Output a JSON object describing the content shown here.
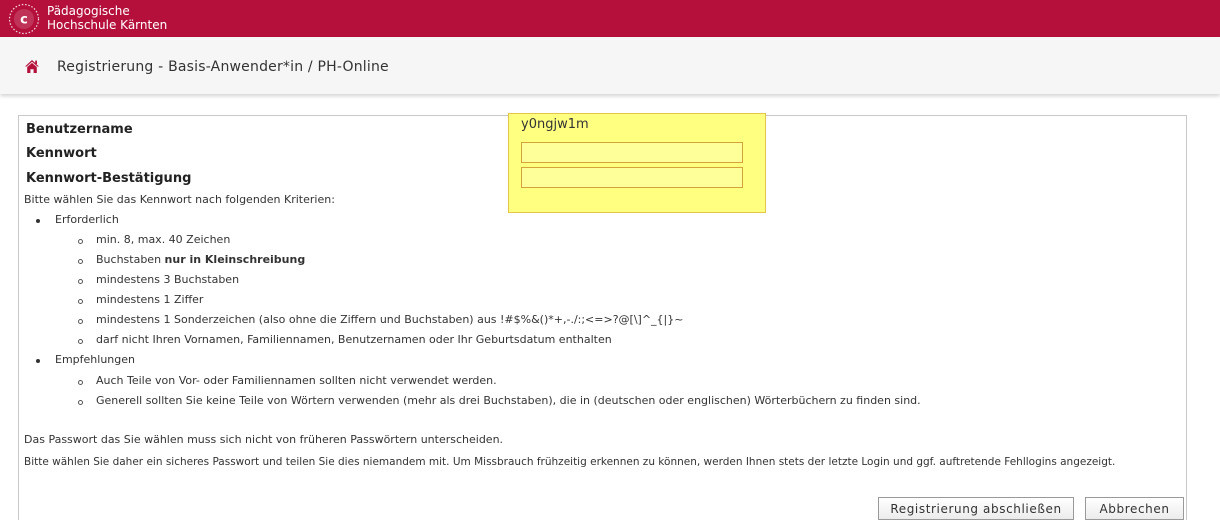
{
  "header": {
    "institution_line1": "Pädagogische",
    "institution_line2": "Hochschule Kärnten",
    "logo_letter": "c",
    "logo_icon": "ph-kaernten-logo"
  },
  "breadcrumb": {
    "home_icon": "home-icon",
    "title": "Registrierung - Basis-Anwender*in / PH-Online"
  },
  "form": {
    "username_label": "Benutzername",
    "username_value": "y0ngjw1m",
    "password_label": "Kennwort",
    "password_value": "",
    "confirm_label": "Kennwort-Bestätigung",
    "confirm_value": ""
  },
  "criteria": {
    "intro": "Bitte wählen Sie das Kennwort nach folgenden Kriterien:",
    "required_heading": "Erforderlich",
    "required": [
      "min. 8, max. 40 Zeichen",
      "mindestens 3 Buchstaben",
      "mindestens 1 Ziffer",
      "mindestens 1 Sonderzeichen (also ohne die Ziffern und Buchstaben) aus !#$%&()*+,-./:;<=>?@[\\]^_{|}~",
      "darf nicht Ihren Vornamen, Familiennamen, Benutzernamen oder Ihr Geburtsdatum enthalten"
    ],
    "letters_prefix": "Buchstaben ",
    "letters_bold": "nur in Kleinschreibung",
    "recommended_heading": "Empfehlungen",
    "recommended": [
      "Auch Teile von Vor- oder Familiennamen sollten nicht verwendet werden.",
      "Generell sollten Sie keine Teile von Wörtern verwenden (mehr als drei Buchstaben), die in (deutschen oder englischen) Wörterbüchern zu finden sind."
    ]
  },
  "notes": {
    "line1": "Das Passwort das Sie wählen muss sich nicht von früheren Passwörtern unterscheiden.",
    "line2": "Bitte wählen Sie daher ein sicheres Passwort und teilen Sie dies niemandem mit. Um Missbrauch frühzeitig erkennen zu können, werden Ihnen stets der letzte Login und ggf. auftretende Fehllogins angezeigt."
  },
  "buttons": {
    "submit": "Registrierung abschließen",
    "cancel": "Abbrechen"
  },
  "colors": {
    "brand": "#b5103c",
    "highlight": "#ffff80",
    "field_bg": "#ffff99"
  }
}
